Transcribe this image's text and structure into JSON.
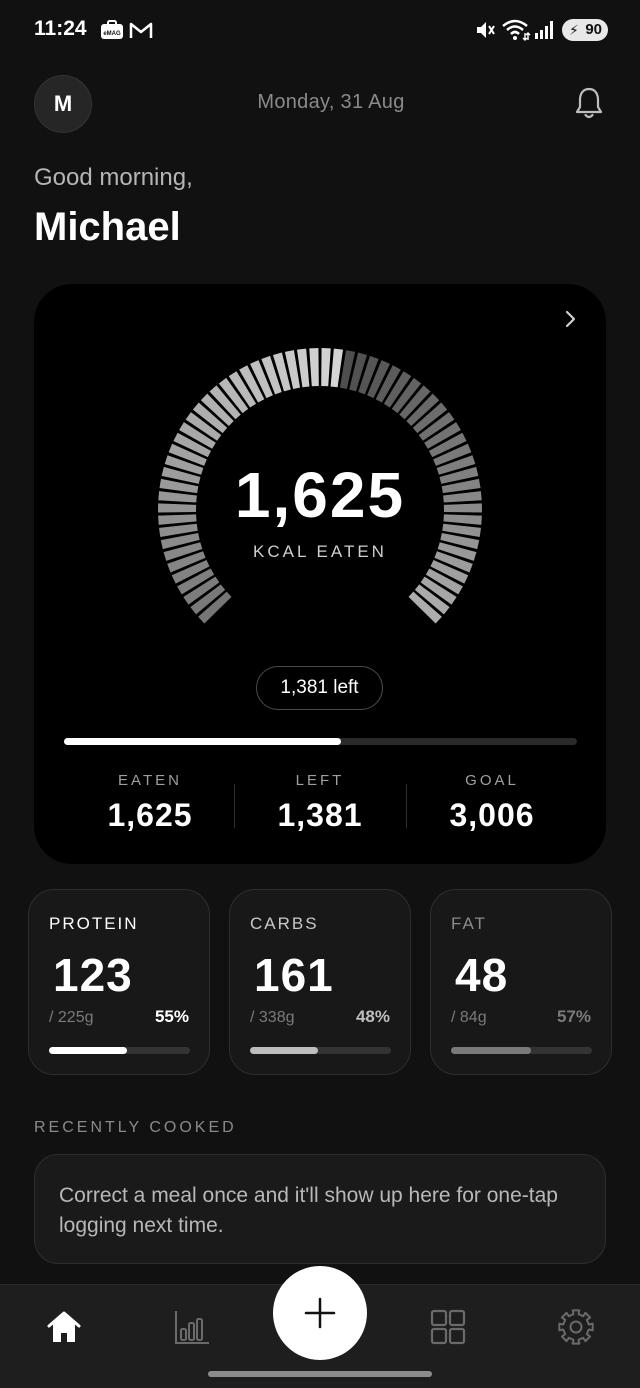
{
  "status_bar": {
    "time": "11:24",
    "notification_icons": [
      "emag-icon",
      "gmail-icon"
    ],
    "system_icons": [
      "mute-icon",
      "wifi-icon",
      "signal-icon"
    ],
    "battery": "90"
  },
  "header": {
    "avatar_initial": "M",
    "date": "Monday, 31 Aug",
    "notification_icon": "bell-icon"
  },
  "greeting": {
    "salutation": "Good morning,",
    "name": "Michael"
  },
  "calorie_card": {
    "eaten_value": "1,625",
    "eaten_caption": "KCAL EATEN",
    "left_pill": "1,381 left",
    "progress_fraction": 0.54,
    "gauge_fraction": 0.54,
    "stats": [
      {
        "label": "EATEN",
        "value": "1,625"
      },
      {
        "label": "LEFT",
        "value": "1,381"
      },
      {
        "label": "GOAL",
        "value": "3,006"
      }
    ]
  },
  "macros": [
    {
      "name": "PROTEIN",
      "value": "123",
      "goal": "/ 225g",
      "percent": "55%",
      "fraction": 0.55,
      "color": "#ffffff",
      "name_color": "#ffffff"
    },
    {
      "name": "CARBS",
      "value": "161",
      "goal": "/ 338g",
      "percent": "48%",
      "fraction": 0.48,
      "color": "#bdbdbd",
      "name_color": "#c8c8c8"
    },
    {
      "name": "FAT",
      "value": "48",
      "goal": "/ 84g",
      "percent": "57%",
      "fraction": 0.57,
      "color": "#7a7a7a",
      "name_color": "#8a8a8a"
    }
  ],
  "recently_cooked": {
    "title": "RECENTLY COOKED",
    "empty_message": "Correct a meal once and it'll show up here for one-tap logging next time."
  },
  "bottom_nav": {
    "items": [
      "home-icon",
      "bar-chart-icon",
      "add-icon",
      "grid-icon",
      "settings-icon"
    ],
    "active": "home-icon"
  },
  "colors": {
    "background": "#111111",
    "card": "#000000",
    "accent": "#ffffff"
  }
}
